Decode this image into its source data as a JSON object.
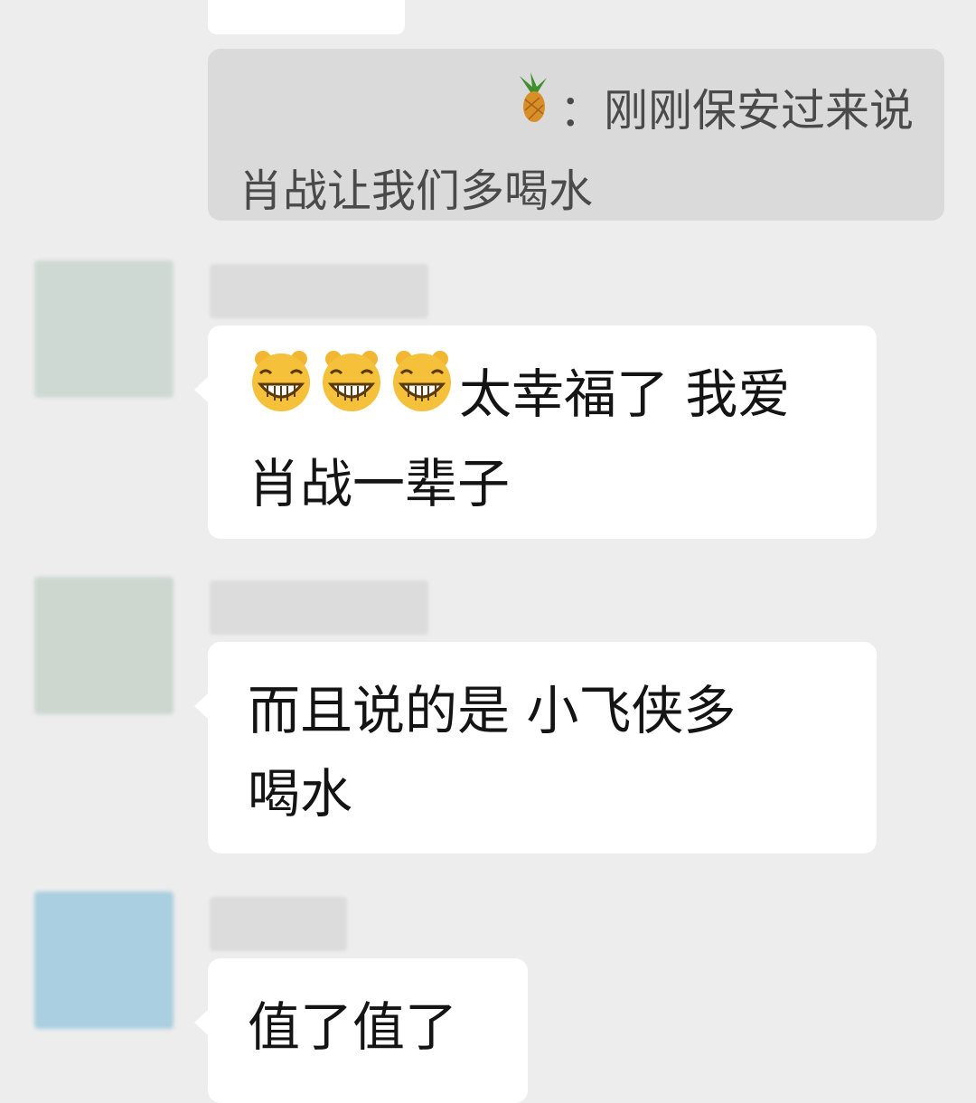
{
  "quote": {
    "emoji": "pineapple-icon",
    "separator": "：",
    "line1": "刚刚保安过来说",
    "line2": "肖战让我们多喝水"
  },
  "messages": [
    {
      "avatar_color": "#cfd9d3",
      "prefix_emoji": "grinning-face-icon",
      "prefix_emoji_count": 3,
      "line1": "太幸福了 我爱",
      "line2": "肖战一辈子"
    },
    {
      "avatar_color": "#cdd6cf",
      "line1": "而且说的是 小飞侠多",
      "line2": "喝水"
    },
    {
      "avatar_color": "#a9cfe0",
      "line1": "值了值了"
    }
  ],
  "colors": {
    "background": "#ededed",
    "bubble": "#ffffff",
    "quote_block": "#dadada",
    "quote_text": "#4a4a4a"
  }
}
